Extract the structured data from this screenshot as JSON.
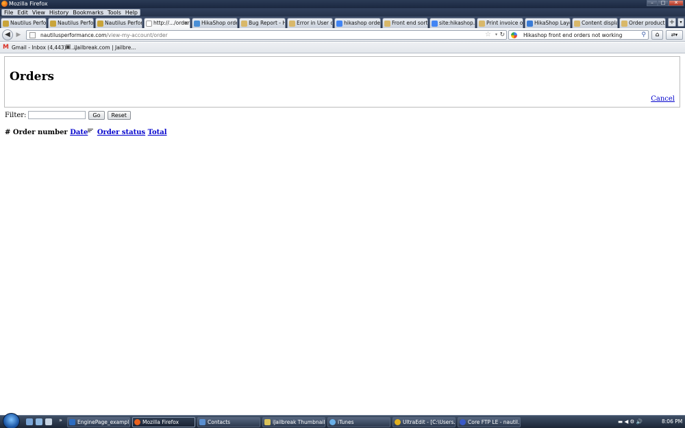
{
  "window": {
    "title": "Mozilla Firefox",
    "minimize": "–",
    "maximize": "□",
    "close": "✕"
  },
  "menu": [
    "File",
    "Edit",
    "View",
    "History",
    "Bookmarks",
    "Tools",
    "Help"
  ],
  "tabs": [
    {
      "label": "Nautilus Perfor...",
      "icon_color": "#c9a43a"
    },
    {
      "label": "Nautilus Perfor...",
      "icon_color": "#c9a43a"
    },
    {
      "label": "Nautilus Perfor...",
      "icon_color": "#c9a43a"
    },
    {
      "label": "http://.../order",
      "icon_color": "#ffffff",
      "active": true
    },
    {
      "label": "HikaShop orde...",
      "icon_color": "#4a8fd6"
    },
    {
      "label": "Bug Report - H...",
      "icon_color": "#d9b86a"
    },
    {
      "label": "Error in User co...",
      "icon_color": "#d9b86a"
    },
    {
      "label": "hikashop order...",
      "icon_color": "#4285f4"
    },
    {
      "label": "Front end sort ...",
      "icon_color": "#d9b86a"
    },
    {
      "label": "site:hikashop.c...",
      "icon_color": "#4285f4"
    },
    {
      "label": "Print invoice o...",
      "icon_color": "#d9b86a"
    },
    {
      "label": "HikaShop Layo...",
      "icon_color": "#3a7bd5"
    },
    {
      "label": "Content displa...",
      "icon_color": "#d9b86a"
    },
    {
      "label": "Order product ...",
      "icon_color": "#d9b86a"
    }
  ],
  "tab_close": "×",
  "new_tab": "+",
  "nav": {
    "back": "◀",
    "forward": "▶",
    "url_host": "nautilusperformance.com",
    "url_path": "/view-my-account/order",
    "star": "☆",
    "dropdown": "▾",
    "reload": "↻",
    "search_text": "Hikashop front end orders not working",
    "search_go": "⚲",
    "home": "⌂",
    "addon": "⇄▾"
  },
  "bookmarks": [
    {
      "label": "Gmail - Inbox (4,443) - ...",
      "icon": "M",
      "icon_color": "#d93025"
    },
    {
      "label": "iJailbreak.com | Jailbre...",
      "icon": "▣",
      "icon_color": "#444"
    }
  ],
  "page": {
    "title": "Orders",
    "cancel": "Cancel",
    "filter_label": "Filter:",
    "filter_value": "",
    "go": "Go",
    "reset": "Reset",
    "columns": {
      "hash": "#",
      "order_number": "Order number",
      "date": "Date",
      "status": "Order status",
      "total": "Total"
    }
  },
  "taskbar": {
    "tasks": [
      {
        "label": "EnginePage_exampl...",
        "icon_color": "#2d6cc0"
      },
      {
        "label": "Mozilla Firefox",
        "icon_color": "#e8601c",
        "active": true
      },
      {
        "label": "Contacts",
        "icon_color": "#5a8fd0"
      },
      {
        "label": "iJailbreak Thumbnails",
        "icon_color": "#d9c25a"
      },
      {
        "label": "iTunes",
        "icon_color": "#6ab0e8"
      },
      {
        "label": "UltraEdit - [C:\\Users...",
        "icon_color": "#e0b020"
      },
      {
        "label": "Core FTP LE - nautil...",
        "icon_color": "#3a5ac8"
      }
    ],
    "clock": "8:06 PM",
    "tray_icons": "▬  ◀  ⚙  🔊"
  }
}
